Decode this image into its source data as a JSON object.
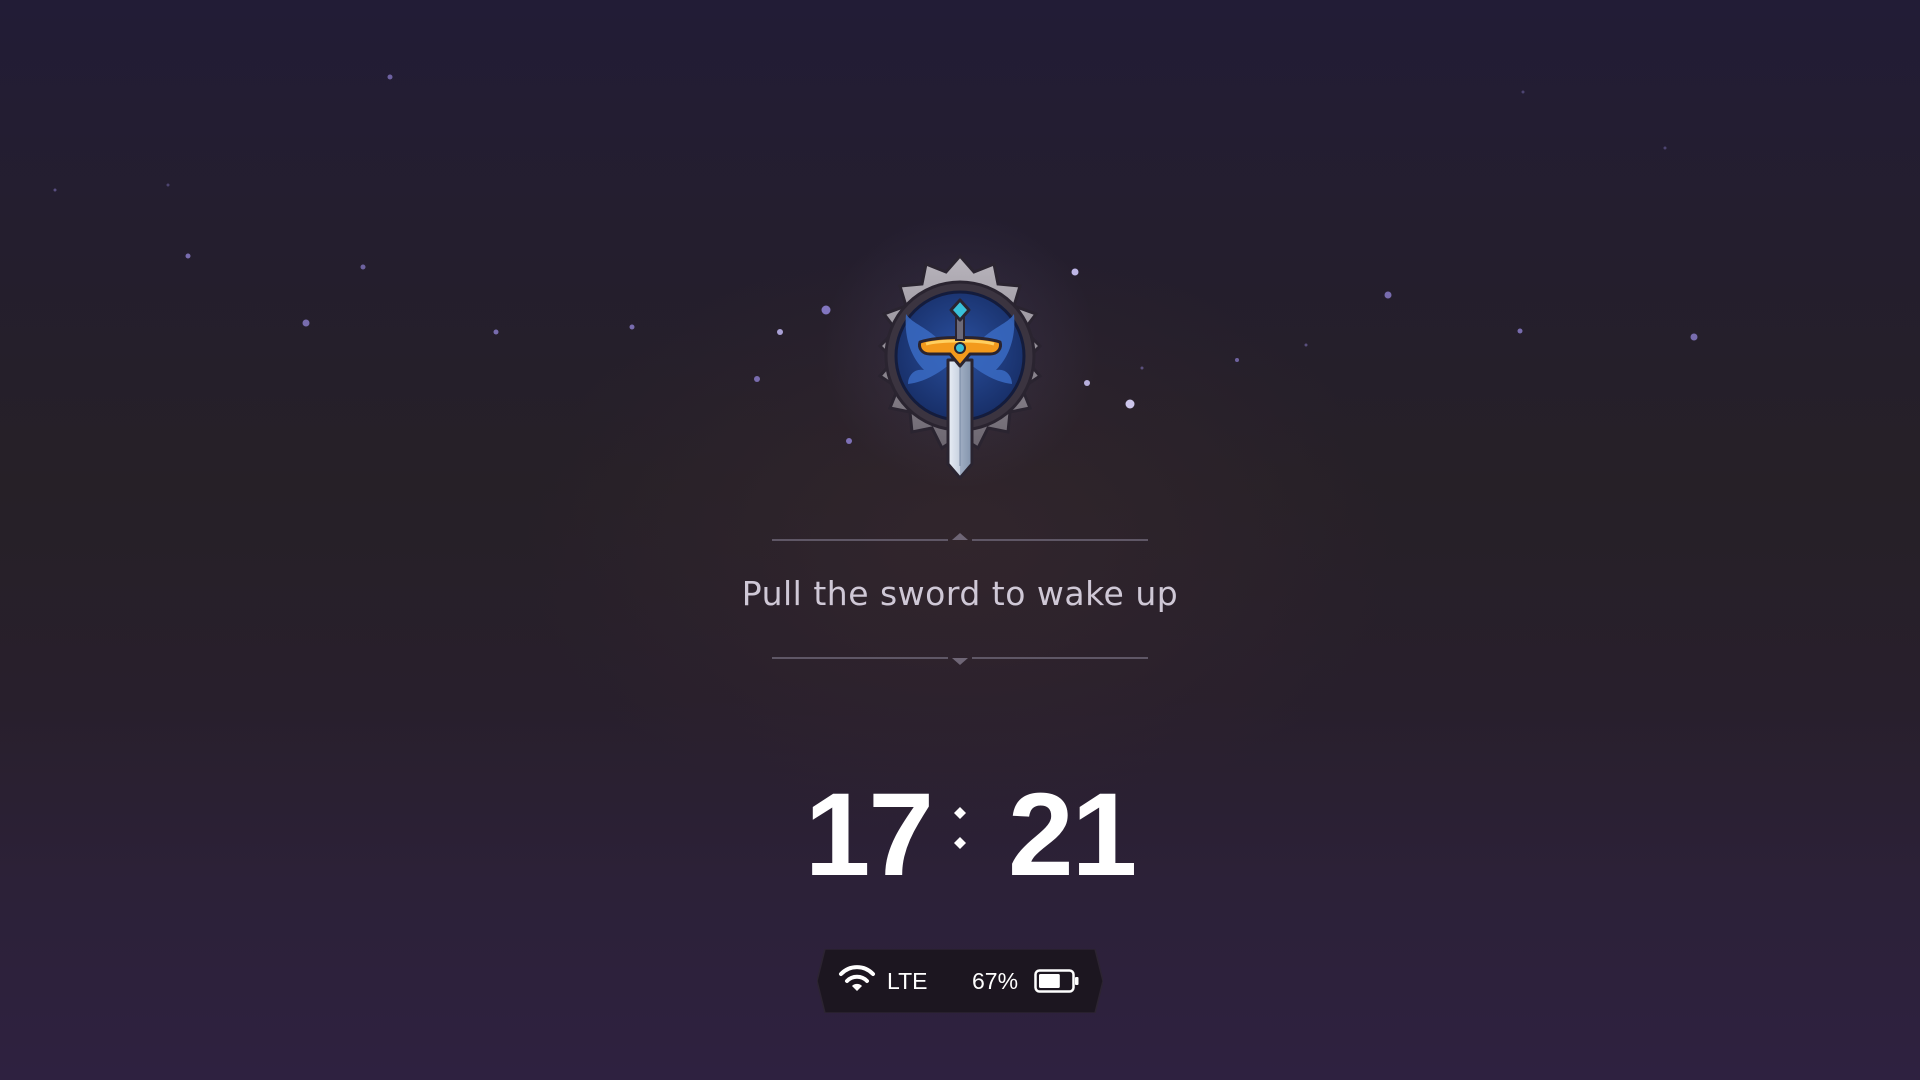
{
  "lockscreen": {
    "prompt": "Pull the sword to wake up",
    "emblem_icon": "sword-emblem-icon"
  },
  "clock": {
    "hours": "17",
    "minutes": "21"
  },
  "status": {
    "network_icon": "wifi-icon",
    "network_label": "LTE",
    "battery_percent": "67%",
    "battery_level": 0.67,
    "battery_icon": "battery-icon"
  },
  "colors": {
    "background_top": "#221c36",
    "background_bottom": "#2e2140",
    "emblem_blue": "#1f3f86",
    "hilt_orange": "#f39a1c",
    "gem_cyan": "#39c0d9",
    "particle": "#8d7fd0"
  }
}
